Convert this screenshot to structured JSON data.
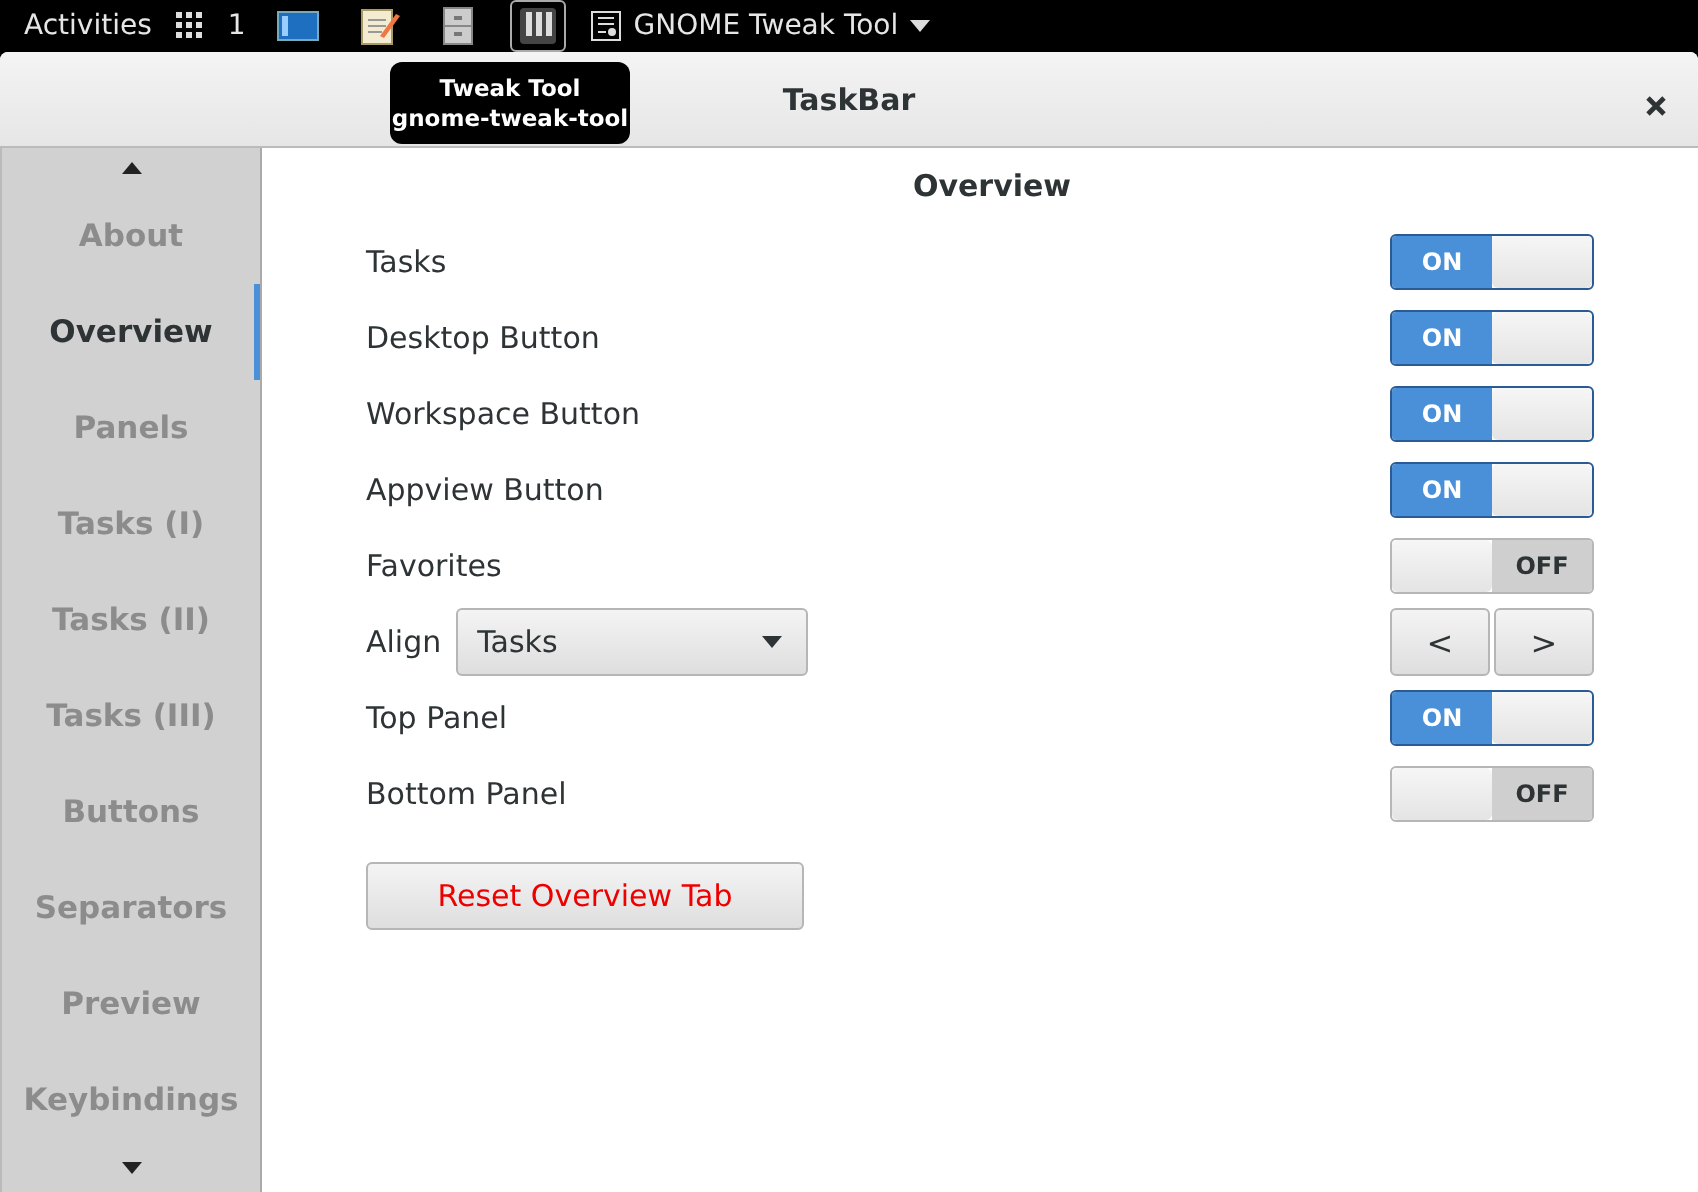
{
  "top_bar": {
    "activities": "Activities",
    "workspace": "1",
    "app_menu": "GNOME Tweak Tool"
  },
  "tooltip": {
    "title": "Tweak Tool",
    "subtitle": "gnome-tweak-tool"
  },
  "window": {
    "title": "TaskBar"
  },
  "sidebar": {
    "items": [
      {
        "label": "About",
        "selected": false
      },
      {
        "label": "Overview",
        "selected": true
      },
      {
        "label": "Panels",
        "selected": false
      },
      {
        "label": "Tasks (I)",
        "selected": false
      },
      {
        "label": "Tasks (II)",
        "selected": false
      },
      {
        "label": "Tasks (III)",
        "selected": false
      },
      {
        "label": "Buttons",
        "selected": false
      },
      {
        "label": "Separators",
        "selected": false
      },
      {
        "label": "Preview",
        "selected": false
      },
      {
        "label": "Keybindings",
        "selected": false
      }
    ]
  },
  "content": {
    "heading": "Overview",
    "settings": [
      {
        "kind": "switch",
        "label": "Tasks",
        "on": true,
        "text": "ON"
      },
      {
        "kind": "switch",
        "label": "Desktop Button",
        "on": true,
        "text": "ON"
      },
      {
        "kind": "switch",
        "label": "Workspace Button",
        "on": true,
        "text": "ON"
      },
      {
        "kind": "switch",
        "label": "Appview Button",
        "on": true,
        "text": "ON"
      },
      {
        "kind": "switch",
        "label": "Favorites",
        "on": false,
        "text": "OFF"
      },
      {
        "kind": "combo",
        "label": "Align",
        "value": "Tasks",
        "prev": "<",
        "next": ">"
      },
      {
        "kind": "switch",
        "label": "Top Panel",
        "on": true,
        "text": "ON"
      },
      {
        "kind": "switch",
        "label": "Bottom Panel",
        "on": false,
        "text": "OFF"
      }
    ],
    "reset_button": "Reset Overview Tab"
  }
}
